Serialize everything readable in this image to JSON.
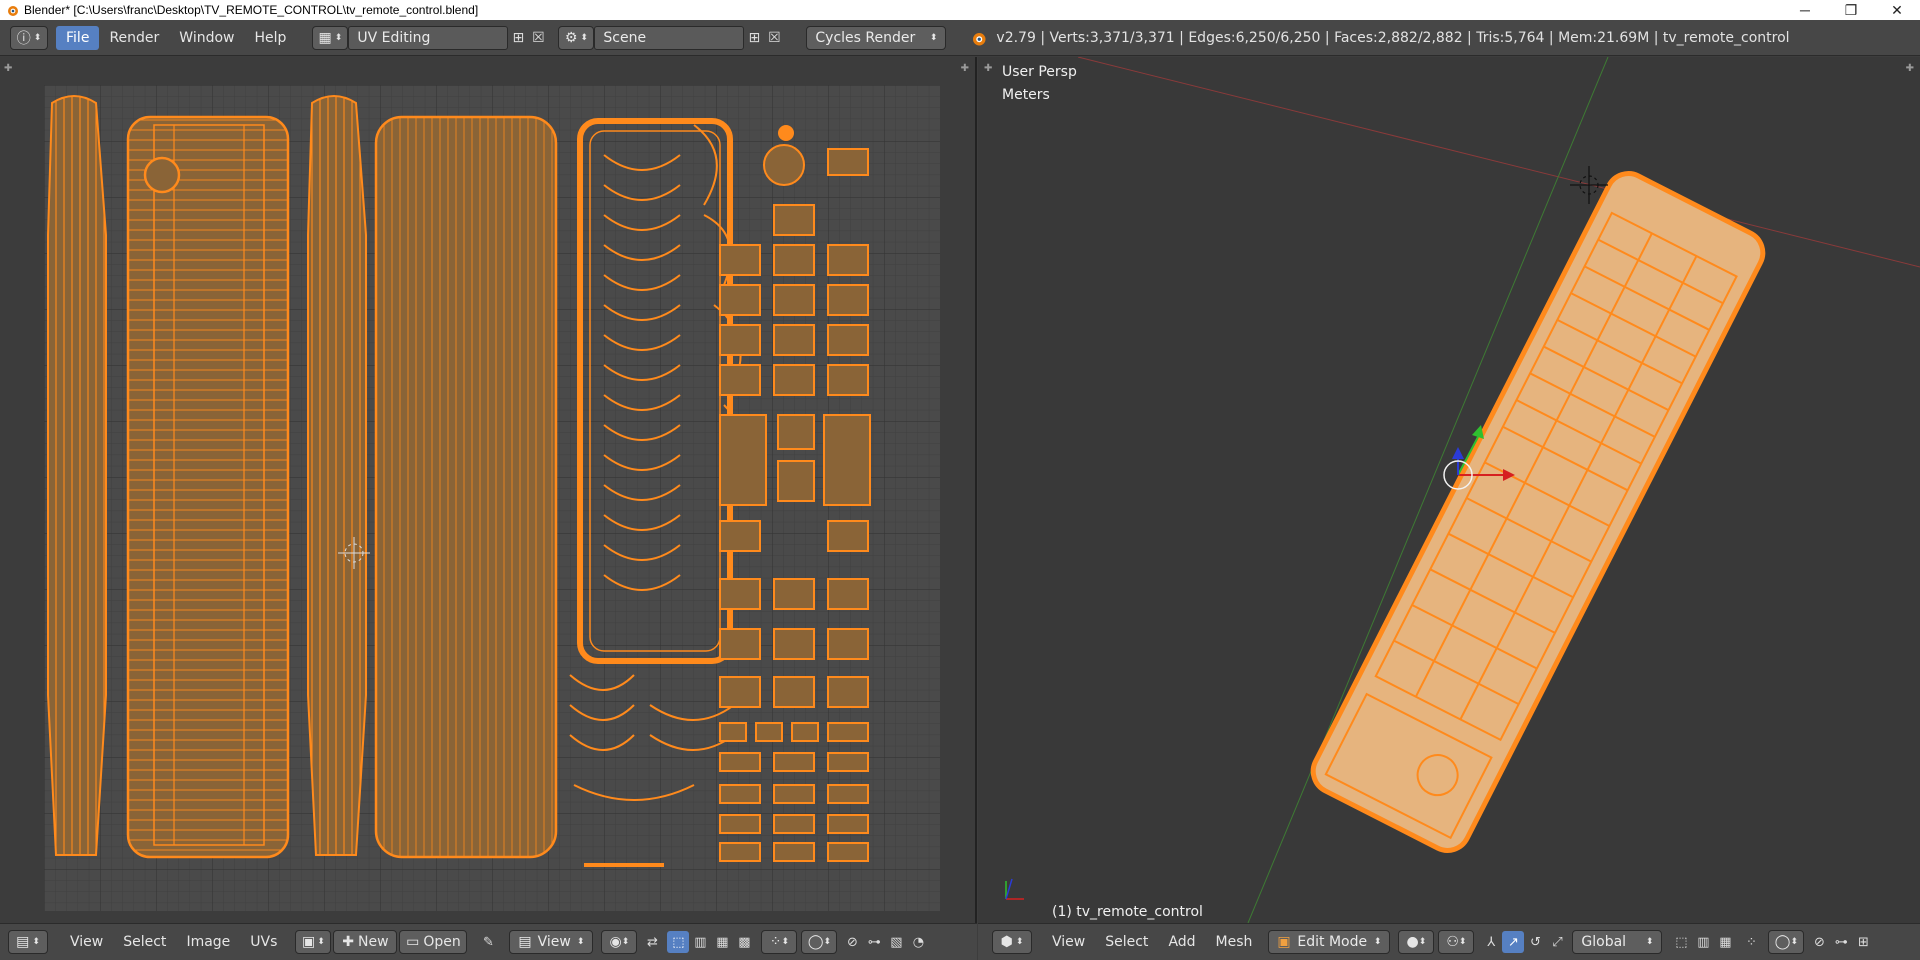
{
  "window": {
    "title": "Blender* [C:\\Users\\franc\\Desktop\\TV_REMOTE_CONTROL\\tv_remote_control.blend]",
    "minimize": "─",
    "restore": "❐",
    "close": "✕"
  },
  "info_header": {
    "editor_icon": "ⓘ",
    "menus": [
      "File",
      "Render",
      "Window",
      "Help"
    ],
    "active_menu": "File",
    "screen_layout": "UV Editing",
    "scene": "Scene",
    "render_engine": "Cycles Render",
    "stats": "v2.79 | Verts:3,371/3,371 | Edges:6,250/6,250 | Faces:2,882/2,882 | Tris:5,764 | Mem:21.69M | tv_remote_control"
  },
  "uv_editor": {
    "bottom": {
      "menus": [
        "View",
        "Select",
        "Image",
        "UVs"
      ],
      "new_label": "New",
      "open_label": "Open",
      "view_label": "View"
    }
  },
  "viewport": {
    "view_name": "User Persp",
    "units": "Meters",
    "object_label": "(1) tv_remote_control",
    "bottom": {
      "menus": [
        "View",
        "Select",
        "Add",
        "Mesh"
      ],
      "mode": "Edit Mode",
      "orientation": "Global"
    }
  },
  "colors": {
    "accent": "#5680c2",
    "uv_fill": "#8a6437",
    "uv_edge": "#ff8a1c",
    "mesh_fill": "#e6b47e",
    "grid_bg": "#4a4a4a"
  }
}
